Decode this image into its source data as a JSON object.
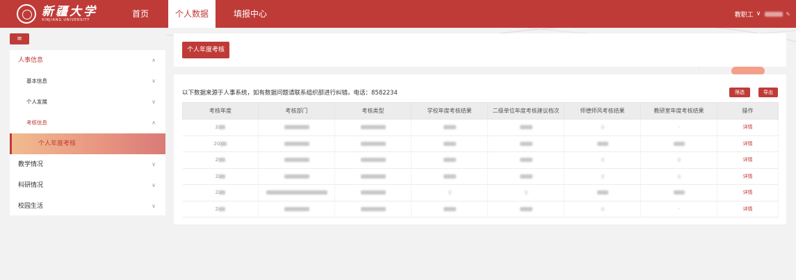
{
  "header": {
    "logo_cn": "新疆大学",
    "logo_en": "XINJIANG UNIVERSITY",
    "nav": [
      {
        "label": "首页"
      },
      {
        "label": "个人数据"
      },
      {
        "label": "填报中心"
      }
    ],
    "user_role": "教职工"
  },
  "sidebar": {
    "groups": [
      {
        "label": "人事信息"
      },
      {
        "label": "基本信息"
      },
      {
        "label": "个人发展"
      },
      {
        "label": "考核信息"
      },
      {
        "label": "个人年度考核"
      },
      {
        "label": "教学情况"
      },
      {
        "label": "科研情况"
      },
      {
        "label": "校园生活"
      }
    ]
  },
  "card1": {
    "button": "个人年度考核"
  },
  "card2": {
    "notice": "以下数据来源于人事系统，如有数据问题请联系组织部进行纠错。电话：8582234",
    "filter_btn": "筛选",
    "export_btn": "导出",
    "columns": [
      "考核年度",
      "考核部门",
      "考核类型",
      "学校年度考核结果",
      "二级单位年度考核建议档次",
      "师德师风考核结果",
      "教研室年度考核结果",
      "操作"
    ],
    "rows": [
      {
        "year": "2",
        "op": "详情"
      },
      {
        "year": "20",
        "op": "详情"
      },
      {
        "year": "2",
        "op": "详情"
      },
      {
        "year": "2",
        "op": "详情"
      },
      {
        "year": "2",
        "op": "详情"
      },
      {
        "year": "2",
        "op": "详情"
      }
    ],
    "dash": "-"
  },
  "colors": {
    "accent": "#bf3b38",
    "active_gradient_start": "#f1bb8e"
  }
}
